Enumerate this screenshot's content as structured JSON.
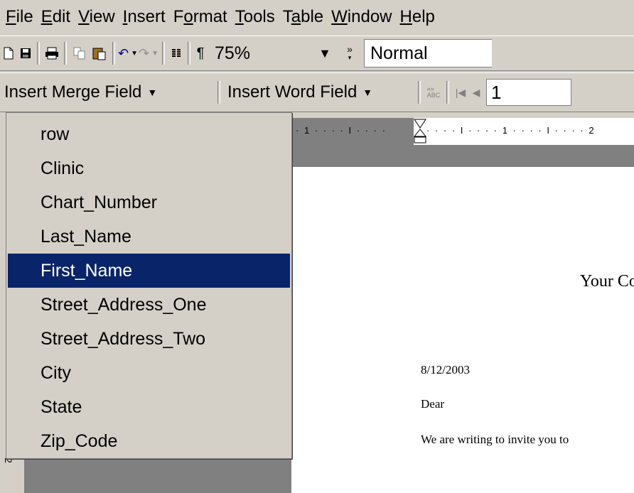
{
  "menubar": {
    "items": [
      {
        "pre": "",
        "u": "F",
        "post": "ile"
      },
      {
        "pre": "",
        "u": "E",
        "post": "dit"
      },
      {
        "pre": "",
        "u": "V",
        "post": "iew"
      },
      {
        "pre": "",
        "u": "I",
        "post": "nsert"
      },
      {
        "pre": "F",
        "u": "o",
        "post": "rmat"
      },
      {
        "pre": "",
        "u": "T",
        "post": "ools"
      },
      {
        "pre": "T",
        "u": "a",
        "post": "ble"
      },
      {
        "pre": "",
        "u": "W",
        "post": "indow"
      },
      {
        "pre": "",
        "u": "H",
        "post": "elp"
      }
    ]
  },
  "toolbar": {
    "zoom": "75%",
    "style": "Normal",
    "pilcrow": "¶"
  },
  "mailmerge": {
    "insert_merge_field": "Insert Merge Field",
    "insert_word_field": "Insert Word Field",
    "record": "1"
  },
  "merge_fields": [
    "row",
    "Clinic",
    "Chart_Number",
    "Last_Name",
    "First_Name",
    "Street_Address_One",
    "Street_Address_Two",
    "City",
    "State",
    "Zip_Code"
  ],
  "selected_field": "First_Name",
  "document": {
    "company": "Your Co",
    "date": "8/12/2003",
    "dear": "Dear",
    "body": "We are writing to invite you to"
  },
  "ruler": {
    "left_marks": "· 1 · · · · I · · · ·",
    "right_marks": "· · · · I · · · · 1 · · · · I · · · · 2",
    "side_number": "2"
  },
  "colors": {
    "highlight": "#0a246a",
    "chrome": "#d4d0c8"
  }
}
